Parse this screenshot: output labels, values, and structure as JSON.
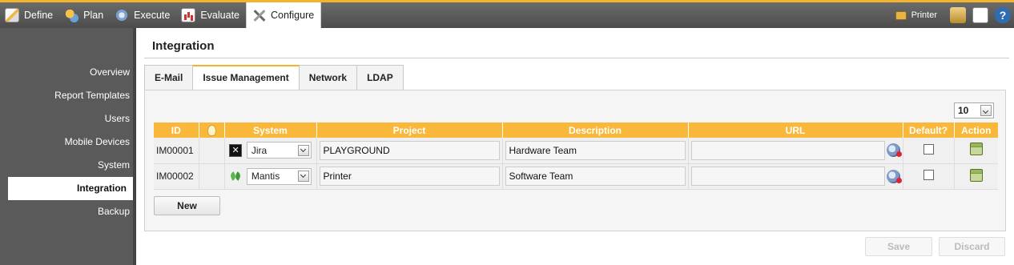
{
  "nav": {
    "items": [
      {
        "label": "Define",
        "icon": "define-icon"
      },
      {
        "label": "Plan",
        "icon": "plan-icon"
      },
      {
        "label": "Execute",
        "icon": "execute-icon"
      },
      {
        "label": "Evaluate",
        "icon": "evaluate-icon"
      },
      {
        "label": "Configure",
        "icon": "configure-icon",
        "active": true
      }
    ],
    "printer_label": "Printer",
    "help_glyph": "?"
  },
  "sidebar": {
    "items": [
      {
        "label": "Overview"
      },
      {
        "label": "Report Templates"
      },
      {
        "label": "Users"
      },
      {
        "label": "Mobile Devices"
      },
      {
        "label": "System"
      },
      {
        "label": "Integration",
        "active": true
      },
      {
        "label": "Backup"
      }
    ]
  },
  "page": {
    "title": "Integration",
    "tabs": [
      {
        "label": "E-Mail"
      },
      {
        "label": "Issue Management",
        "active": true
      },
      {
        "label": "Network"
      },
      {
        "label": "LDAP"
      }
    ],
    "page_size": "10"
  },
  "table": {
    "headers": {
      "id": "ID",
      "system": "System",
      "project": "Project",
      "description": "Description",
      "url": "URL",
      "default": "Default?",
      "action": "Action"
    },
    "rows": [
      {
        "id": "IM00001",
        "system": "Jira",
        "system_icon": "jira-icon",
        "project": "PLAYGROUND",
        "description": "Hardware Team",
        "url": "",
        "default": false
      },
      {
        "id": "IM00002",
        "system": "Mantis",
        "system_icon": "mantis-icon",
        "project": "Printer",
        "description": "Software Team",
        "url": "",
        "default": false
      }
    ]
  },
  "buttons": {
    "new": "New",
    "save": "Save",
    "discard": "Discard"
  },
  "colors": {
    "accent": "#f9b83a",
    "nav_bg": "#5a5a5a"
  }
}
